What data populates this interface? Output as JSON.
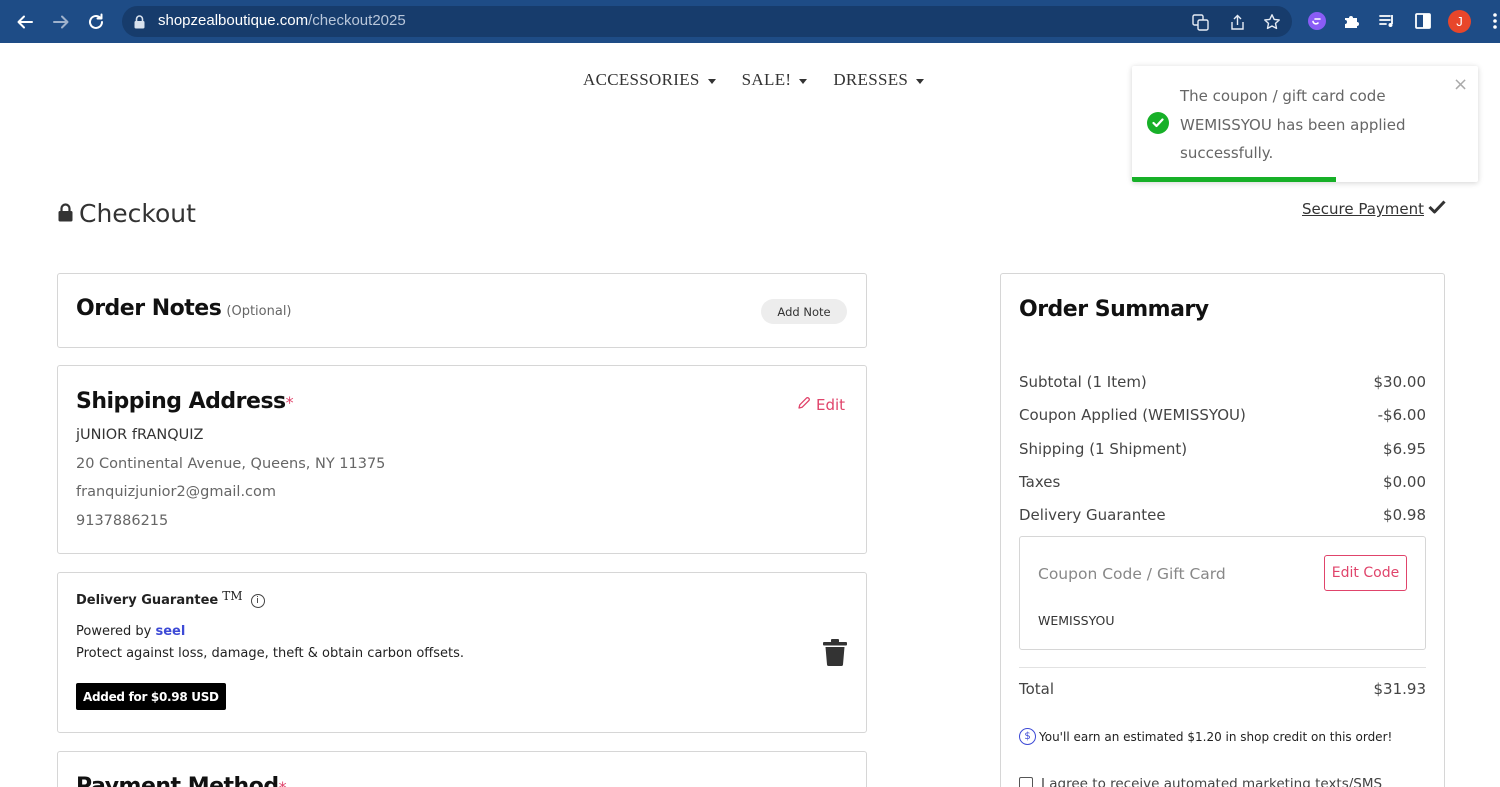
{
  "browser": {
    "url_host": "shopzealboutique.com",
    "url_path": "/checkout2025",
    "avatar_letter": "J"
  },
  "store_nav": {
    "items": [
      {
        "label": "ACCESSORIES"
      },
      {
        "label": "SALE!"
      },
      {
        "label": "DRESSES"
      }
    ]
  },
  "toast": {
    "message": "The coupon / gift card code WEMISSYOU has been applied successfully.",
    "close": "×",
    "progress": 0.59,
    "accent": "#17b028"
  },
  "page": {
    "title": "Checkout",
    "secure_payment": "Secure Payment"
  },
  "order_notes": {
    "title": "Order Notes",
    "optional": "(Optional)",
    "button": "Add Note"
  },
  "shipping": {
    "title": "Shipping Address",
    "required_mark": "*",
    "edit": "Edit",
    "name": "jUNIOR fRANQUIZ",
    "address": "20 Continental Avenue, Queens, NY 11375",
    "email": "franquizjunior2@gmail.com",
    "phone": "9137886215"
  },
  "delivery_guarantee": {
    "title": "Delivery Guarantee",
    "tm": "TM",
    "info": "i",
    "powered_prefix": "Powered by ",
    "powered_brand": "seel",
    "description": "Protect against loss, damage, theft & obtain carbon offsets.",
    "badge": "Added for $0.98 USD"
  },
  "payment": {
    "title": "Payment Method",
    "required_mark": "*"
  },
  "summary": {
    "title": "Order Summary",
    "rows": [
      {
        "label": "Subtotal (1 Item)",
        "value": "$30.00"
      },
      {
        "label": "Coupon Applied (WEMISSYOU)",
        "value": "-$6.00"
      },
      {
        "label": "Shipping (1 Shipment)",
        "value": "$6.95"
      },
      {
        "label": "Taxes",
        "value": "$0.00"
      },
      {
        "label": "Delivery Guarantee",
        "value": "$0.98"
      }
    ],
    "coupon_placeholder": "Coupon Code / Gift Card",
    "edit_code": "Edit Code",
    "coupon_code": "WEMISSYOU",
    "total_label": "Total",
    "total_value": "$31.93",
    "credit_icon": "$",
    "credit_text": "You'll earn an estimated $1.20 in shop credit on this order!",
    "agree_text": "I agree to receive automated marketing texts/SMS"
  },
  "colors": {
    "browser_bar": "#1e4c86",
    "accent_pink": "#e0446b",
    "seel_blue": "#3d4ad6",
    "success_green": "#17b028"
  }
}
